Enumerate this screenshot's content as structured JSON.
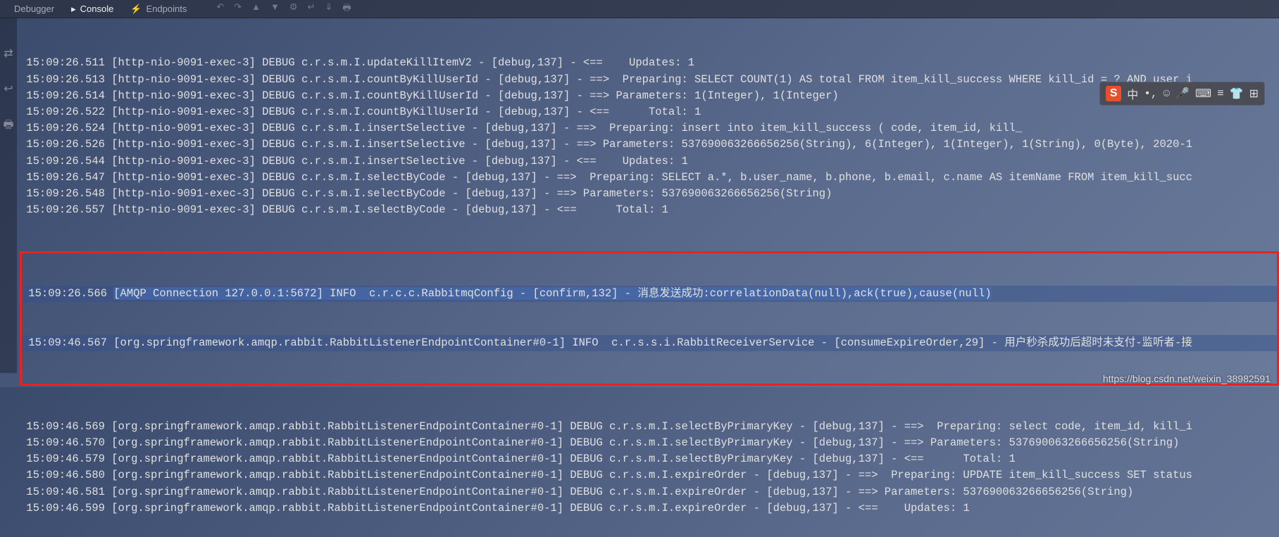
{
  "tabs": {
    "debugger": "Debugger",
    "console": "Console",
    "endpoints": "Endpoints"
  },
  "logs": [
    " 15:09:26.511 [http-nio-9091-exec-3] DEBUG c.r.s.m.I.updateKillItemV2 - [debug,137] - <==    Updates: 1",
    " 15:09:26.513 [http-nio-9091-exec-3] DEBUG c.r.s.m.I.countByKillUserId - [debug,137] - ==>  Preparing: SELECT COUNT(1) AS total FROM item_kill_success WHERE kill_id = ? AND user_i",
    " 15:09:26.514 [http-nio-9091-exec-3] DEBUG c.r.s.m.I.countByKillUserId - [debug,137] - ==> Parameters: 1(Integer), 1(Integer)",
    " 15:09:26.522 [http-nio-9091-exec-3] DEBUG c.r.s.m.I.countByKillUserId - [debug,137] - <==      Total: 1",
    " 15:09:26.524 [http-nio-9091-exec-3] DEBUG c.r.s.m.I.insertSelective - [debug,137] - ==>  Preparing: insert into item_kill_success ( code, item_id, kill_",
    " 15:09:26.526 [http-nio-9091-exec-3] DEBUG c.r.s.m.I.insertSelective - [debug,137] - ==> Parameters: 537690063266656256(String), 6(Integer), 1(Integer), 1(String), 0(Byte), 2020-1",
    " 15:09:26.544 [http-nio-9091-exec-3] DEBUG c.r.s.m.I.insertSelective - [debug,137] - <==    Updates: 1",
    " 15:09:26.547 [http-nio-9091-exec-3] DEBUG c.r.s.m.I.selectByCode - [debug,137] - ==>  Preparing: SELECT a.*, b.user_name, b.phone, b.email, c.name AS itemName FROM item_kill_succ",
    " 15:09:26.548 [http-nio-9091-exec-3] DEBUG c.r.s.m.I.selectByCode - [debug,137] - ==> Parameters: 537690063266656256(String)",
    " 15:09:26.557 [http-nio-9091-exec-3] DEBUG c.r.s.m.I.selectByCode - [debug,137] - <==      Total: 1"
  ],
  "highlighted_logs": [
    " 15:09:26.566 [AMQP Connection 127.0.0.1:5672] INFO  c.r.c.c.RabbitmqConfig - [confirm,132] - 消息发送成功:correlationData(null),ack(true),cause(null)",
    " 15:09:46.567 [org.springframework.amqp.rabbit.RabbitListenerEndpointContainer#0-1] INFO  c.r.s.s.i.RabbitReceiverService - [consumeExpireOrder,29] - 用户秒杀成功后超时未支付-监听者-接"
  ],
  "logs_after": [
    " 15:09:46.569 [org.springframework.amqp.rabbit.RabbitListenerEndpointContainer#0-1] DEBUG c.r.s.m.I.selectByPrimaryKey - [debug,137] - ==>  Preparing: select code, item_id, kill_i",
    " 15:09:46.570 [org.springframework.amqp.rabbit.RabbitListenerEndpointContainer#0-1] DEBUG c.r.s.m.I.selectByPrimaryKey - [debug,137] - ==> Parameters: 537690063266656256(String)",
    " 15:09:46.579 [org.springframework.amqp.rabbit.RabbitListenerEndpointContainer#0-1] DEBUG c.r.s.m.I.selectByPrimaryKey - [debug,137] - <==      Total: 1",
    " 15:09:46.580 [org.springframework.amqp.rabbit.RabbitListenerEndpointContainer#0-1] DEBUG c.r.s.m.I.expireOrder - [debug,137] - ==>  Preparing: UPDATE item_kill_success SET status",
    " 15:09:46.581 [org.springframework.amqp.rabbit.RabbitListenerEndpointContainer#0-1] DEBUG c.r.s.m.I.expireOrder - [debug,137] - ==> Parameters: 537690063266656256(String)",
    " 15:09:46.599 [org.springframework.amqp.rabbit.RabbitListenerEndpointContainer#0-1] DEBUG c.r.s.m.I.expireOrder - [debug,137] - <==    Updates: 1"
  ],
  "watermark": "https://blog.csdn.net/weixin_38982591",
  "ime": {
    "s": "S",
    "chars": [
      "中",
      "•,",
      "☺",
      "🎤",
      "⌨",
      "≡",
      "👕",
      "⊞"
    ]
  }
}
